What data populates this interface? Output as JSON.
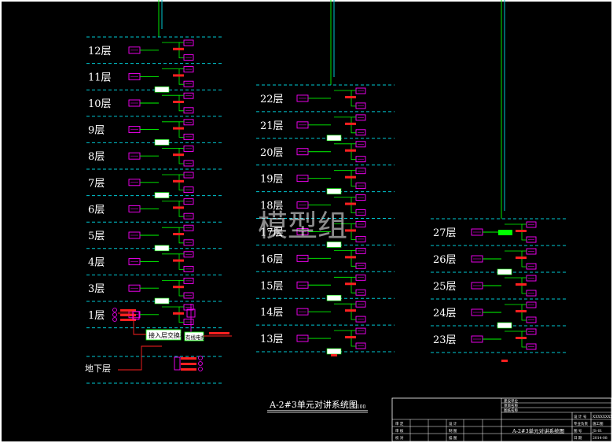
{
  "panels": [
    {
      "id": "left",
      "floors": [
        "12层",
        "11层",
        "10层",
        "9层",
        "8层",
        "7层",
        "6层",
        "5层",
        "4层",
        "3层",
        "1层"
      ],
      "basement": "地下层",
      "exchange_label": "接入层交换机",
      "exchange_label2": "有线电视"
    },
    {
      "id": "middle",
      "floors": [
        "22层",
        "21层",
        "20层",
        "19层",
        "18层",
        "17层",
        "16层",
        "15层",
        "14层",
        "13层"
      ]
    },
    {
      "id": "right",
      "floors": [
        "27层",
        "26层",
        "25层",
        "24层",
        "23层"
      ]
    }
  ],
  "watermark": "模型组",
  "title": "A-2#3单元对讲系统图",
  "title_scale": "1:100",
  "title_block": {
    "rows_right": [
      "建设单位",
      "项目名称",
      "图纸名称"
    ],
    "drawing_name": "A-2#3单元对讲系统图",
    "labels_left": [
      "审 定",
      "审 核",
      "校 对"
    ],
    "labels_mid": [
      "设 计",
      "制 图",
      "描 图"
    ],
    "labels_far": [
      "设 计 号",
      "专业负责",
      "图 号",
      "日 期"
    ],
    "values_far": [
      "XXXXXXXX",
      "施工图",
      "JS-01",
      "2014-08"
    ]
  },
  "colors": {
    "bg": "#000000",
    "cyan": "#00c8d2",
    "green": "#00ff00",
    "magenta": "#ff00ff",
    "red": "#ff2020",
    "white": "#ffffff"
  }
}
